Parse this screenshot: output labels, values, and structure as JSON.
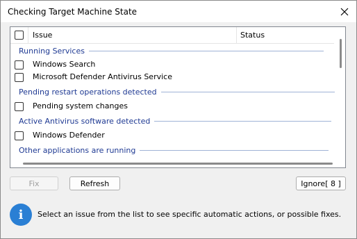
{
  "window": {
    "title": "Checking Target Machine State"
  },
  "table": {
    "headers": {
      "issue": "Issue",
      "status": "Status"
    },
    "groups": [
      {
        "label": "Running Services",
        "items": [
          "Windows Search",
          "Microsoft Defender Antivirus Service"
        ]
      },
      {
        "label": "Pending restart operations detected",
        "items": [
          "Pending system changes"
        ]
      },
      {
        "label": "Active Antivirus software detected",
        "items": [
          "Windows Defender"
        ]
      },
      {
        "label": "Other applications are running",
        "items": []
      }
    ]
  },
  "buttons": {
    "fix": "Fix",
    "refresh": "Refresh",
    "ignore": "Ignore[ 8 ]"
  },
  "info": {
    "icon": "info-icon",
    "text": "Select an issue from the list to see specific automatic actions, or possible fixes."
  },
  "colors": {
    "group_text": "#1f3a93",
    "info_icon": "#2a7fd4"
  }
}
